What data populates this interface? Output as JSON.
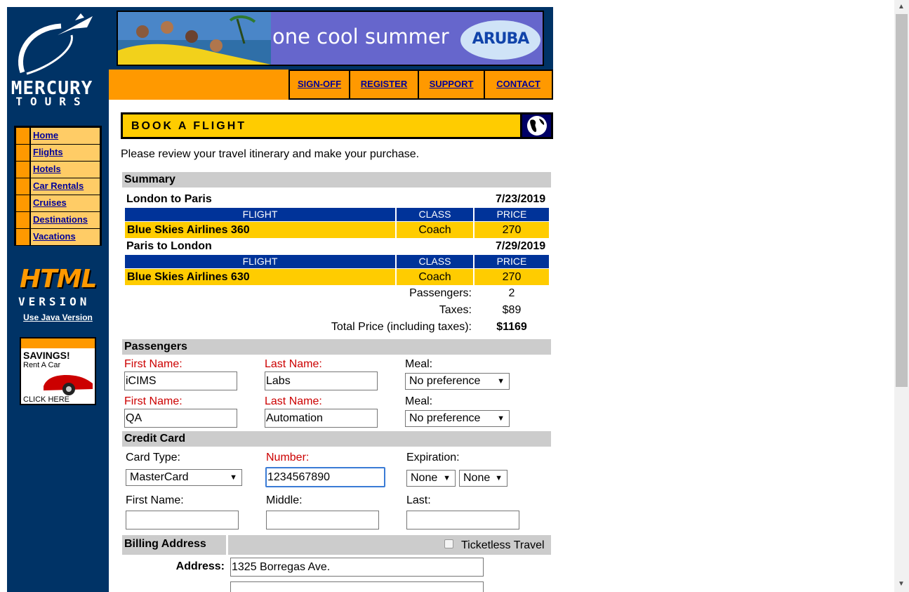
{
  "sidebar": {
    "logo": {
      "line1": "MERCURY",
      "line2": "TOURS"
    },
    "nav": [
      {
        "label": "Home"
      },
      {
        "label": "Flights"
      },
      {
        "label": "Hotels"
      },
      {
        "label": "Car Rentals"
      },
      {
        "label": "Cruises"
      },
      {
        "label": "Destinations"
      },
      {
        "label": "Vacations"
      }
    ],
    "html_version": {
      "big": "HTML",
      "small": "VERSION"
    },
    "java_link": "Use Java Version",
    "ad": {
      "title": "SAVINGS!",
      "subtitle": "Rent A Car",
      "cta": "CLICK HERE"
    }
  },
  "banner": {
    "slogan": "one cool summer",
    "brand": "ARUBA"
  },
  "topnav": {
    "signoff": "SIGN-OFF",
    "register": "REGISTER",
    "support": "SUPPORT",
    "contact": "CONTACT"
  },
  "page": {
    "title": "BOOK A FLIGHT",
    "intro": "Please review your travel itinerary and make your purchase."
  },
  "summary": {
    "heading": "Summary",
    "columns": {
      "flight": "FLIGHT",
      "class": "CLASS",
      "price": "PRICE"
    },
    "legs": [
      {
        "route": "London to Paris",
        "date": "7/23/2019",
        "flight": "Blue Skies Airlines 360",
        "class": "Coach",
        "price": "270"
      },
      {
        "route": "Paris to London",
        "date": "7/29/2019",
        "flight": "Blue Skies Airlines 630",
        "class": "Coach",
        "price": "270"
      }
    ],
    "passengers_label": "Passengers:",
    "passengers_value": "2",
    "taxes_label": "Taxes:",
    "taxes_value": "$89",
    "total_label": "Total Price (including taxes):",
    "total_value": "$1169"
  },
  "passengers": {
    "heading": "Passengers",
    "first_name_label": "First Name:",
    "last_name_label": "Last Name:",
    "meal_label": "Meal:",
    "rows": [
      {
        "first": "iCIMS",
        "last": "Labs",
        "meal": "No preference"
      },
      {
        "first": "QA",
        "last": "Automation",
        "meal": "No preference"
      }
    ]
  },
  "credit_card": {
    "heading": "Credit Card",
    "card_type_label": "Card Type:",
    "card_type": "MasterCard",
    "number_label": "Number:",
    "number": "1234567890",
    "expiration_label": "Expiration:",
    "exp_month": "None",
    "exp_year": "None",
    "first_label": "First Name:",
    "middle_label": "Middle:",
    "last_label": "Last:",
    "first": "",
    "middle": "",
    "last": ""
  },
  "billing": {
    "heading": "Billing Address",
    "ticketless_label": "Ticketless Travel",
    "ticketless_checked": false,
    "address_label": "Address:",
    "address1": "1325 Borregas Ave.",
    "address2": ""
  },
  "colors": {
    "navy": "#003366",
    "orange": "#ff9900",
    "yellow": "#ffcc00",
    "header_blue": "#003399",
    "link": "#000099",
    "required_red": "#cc0000"
  }
}
